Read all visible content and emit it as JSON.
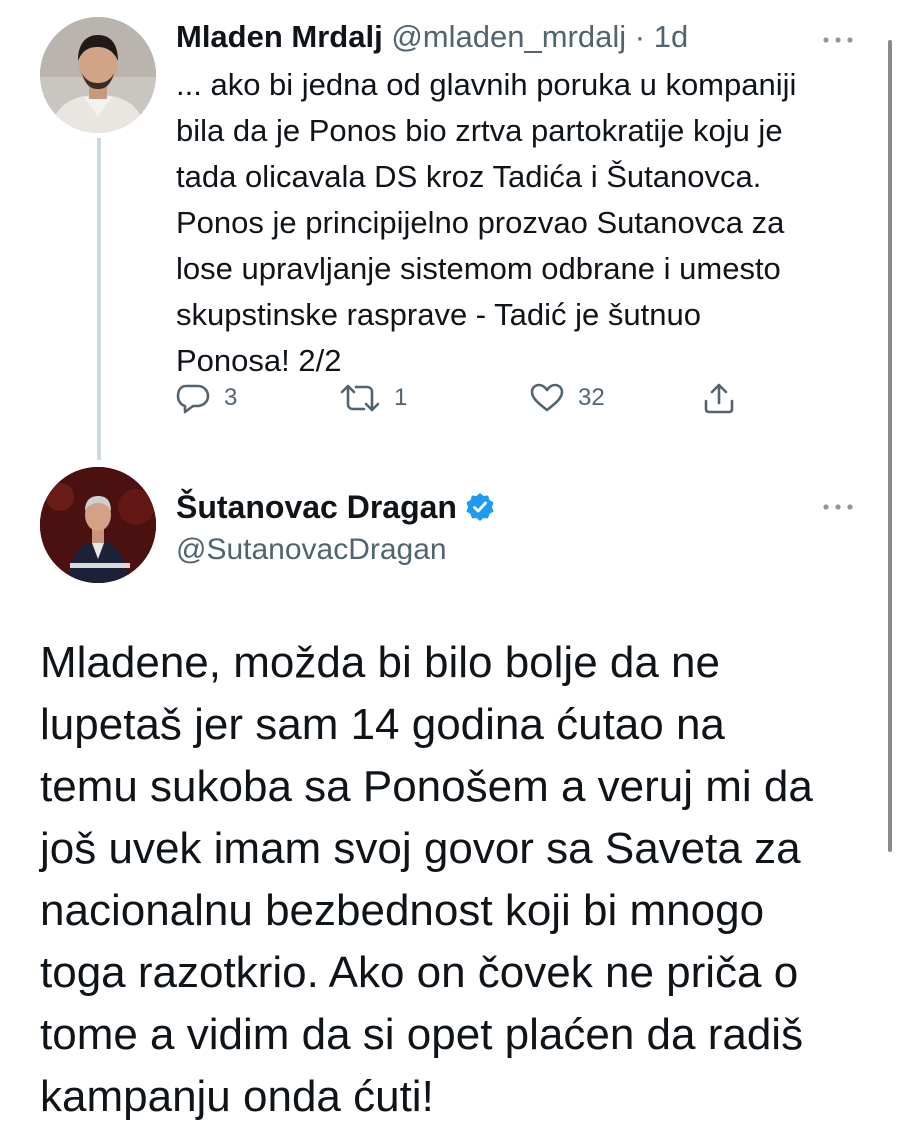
{
  "tweets": [
    {
      "author_name": "Mladen Mrdalj",
      "handle": "@mladen_mrdalj",
      "separator": "·",
      "time": "1d",
      "body_lines": [
        "... ako bi jedna od glavnih poruka u kompaniji",
        "bila da je Ponos bio zrtva partokratije koju je",
        "tada olicavala DS kroz Tadića i Šutanovca.",
        "Ponos je principijelno prozvao Sutanovca za",
        "lose upravljanje sistemom odbrane i umesto",
        "skupstinske rasprave - Tadić je šutnuo",
        "Ponosa! 2/2"
      ],
      "actions": {
        "reply_count": "3",
        "retweet_count": "1",
        "like_count": "32"
      }
    },
    {
      "author_name": "Šutanovac Dragan",
      "handle": "@SutanovacDragan",
      "verified": true,
      "body_lines": [
        "Mladene, možda bi bilo bolje da ne",
        "lupetaš jer sam 14 godina ćutao na",
        "temu sukoba sa Ponošem a veruj mi da",
        "još uvek imam svoj govor sa Saveta za",
        "nacionalnu bezbednost koji bi mnogo",
        "toga razotkrio. Ako on čovek ne priča o",
        "tome a vidim da si opet plaćen da radiš",
        "kampanju onda ćuti!"
      ]
    }
  ],
  "icons": {
    "more": "more-icon",
    "reply": "reply-icon",
    "retweet": "retweet-icon",
    "like": "like-icon",
    "share": "share-icon",
    "verified": "verified-badge-icon"
  },
  "colors": {
    "text": "#0f1419",
    "secondary": "#536471",
    "verified": "#1d9bf0",
    "thread_line": "#cfd9de"
  }
}
